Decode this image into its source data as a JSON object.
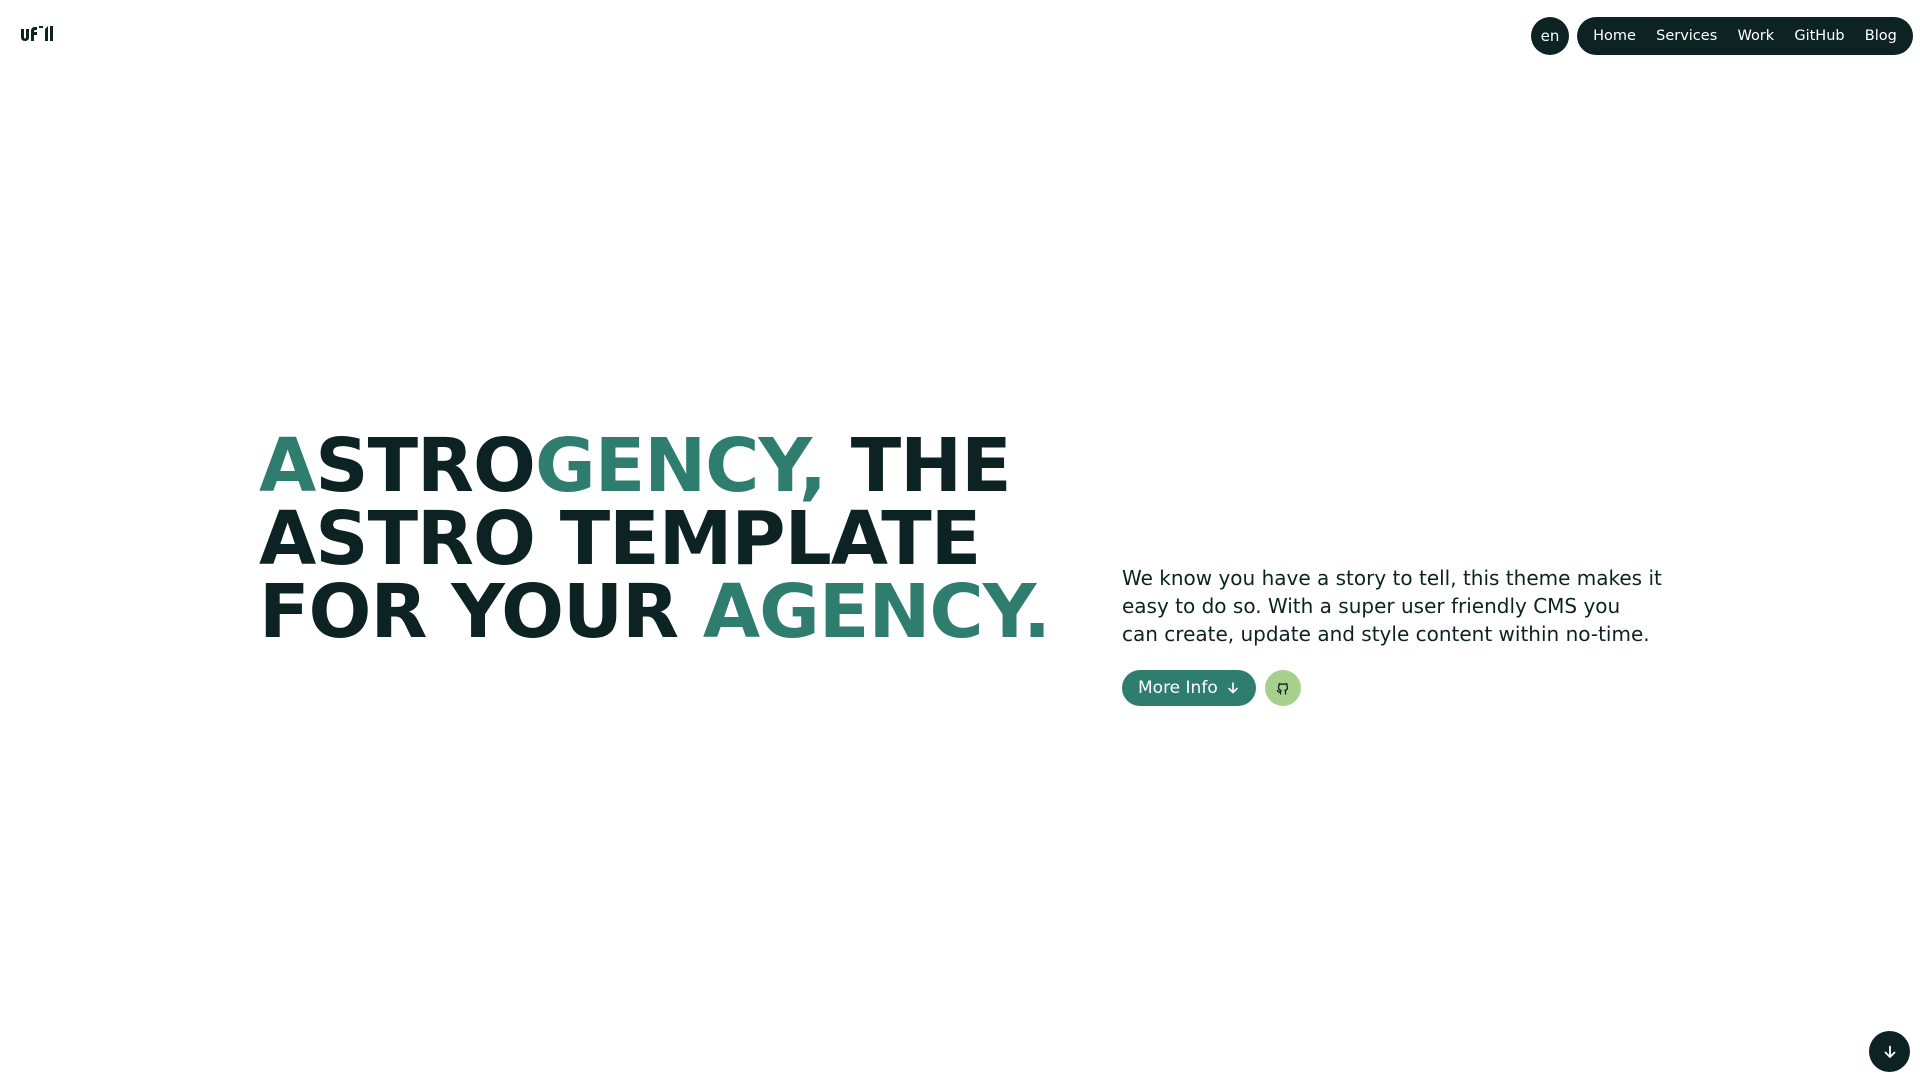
{
  "header": {
    "logo_icon": "ufl-logo",
    "language": "en",
    "nav": [
      {
        "label": "Home"
      },
      {
        "label": "Services"
      },
      {
        "label": "Work"
      },
      {
        "label": "GitHub"
      },
      {
        "label": "Blog"
      }
    ]
  },
  "hero": {
    "title_parts": {
      "a": "A",
      "stro": "STRO",
      "gency": "GENCY,",
      "the": " THE",
      "line2": "ASTRO TEMPLATE",
      "for_your": "FOR YOUR ",
      "agency": "AGENCY."
    },
    "description": "We know you have a story to tell, this theme makes it easy to do so. With a super user friendly CMS you can create, update and style content within no-time.",
    "more_info_label": "More Info",
    "more_info_icon": "arrow-down-icon",
    "github_icon": "github-icon"
  },
  "scroll": {
    "icon": "arrow-down-icon"
  },
  "colors": {
    "dark": "#0d2323",
    "accent": "#2e7d6f",
    "light_green": "#a8d08d",
    "background": "#ffffff"
  }
}
